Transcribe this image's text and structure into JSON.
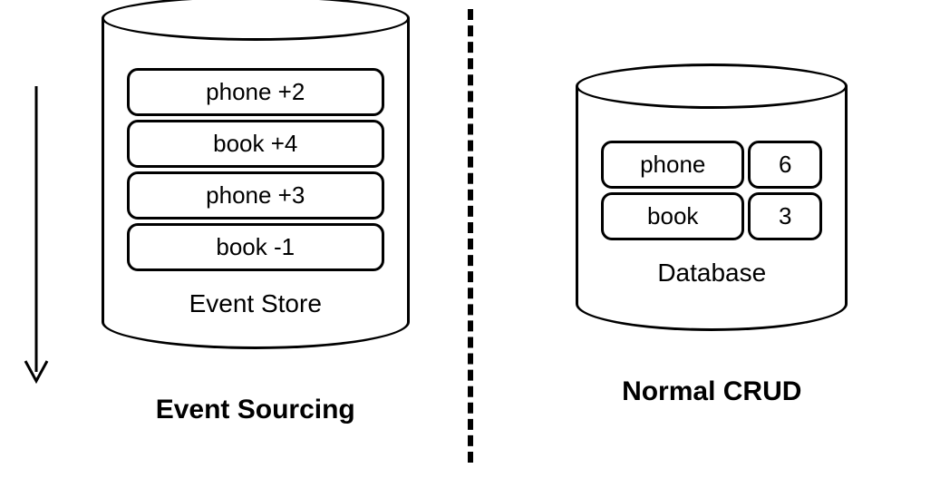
{
  "left": {
    "title": "Event Sourcing",
    "cylinderLabel": "Event Store",
    "events": [
      "phone +2",
      "book +4",
      "phone +3",
      "book -1"
    ]
  },
  "right": {
    "title": "Normal CRUD",
    "cylinderLabel": "Database",
    "rows": [
      {
        "name": "phone",
        "value": "6"
      },
      {
        "name": "book",
        "value": "3"
      }
    ]
  }
}
